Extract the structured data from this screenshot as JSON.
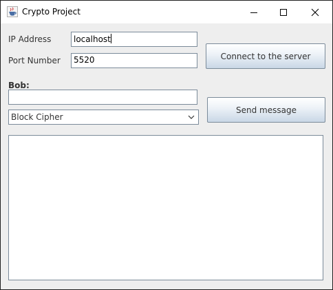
{
  "window": {
    "title": "Crypto Project",
    "app_icon": "java-cup-icon",
    "controls": {
      "minimize_icon": "minimize-icon",
      "maximize_icon": "maximize-icon",
      "close_icon": "close-icon"
    }
  },
  "form": {
    "ip_label": "IP Address",
    "ip_value": "localhost",
    "port_label": "Port Number",
    "port_value": "5520",
    "connect_button": "Connect to the server",
    "sender_label": "Bob:",
    "message_value": "",
    "cipher_selected": "Block Cipher",
    "send_button": "Send message",
    "log_text": ""
  },
  "colors": {
    "window_bg": "#eeeeee",
    "titlebar_bg": "#ffffff",
    "border": "#7a8a99"
  }
}
